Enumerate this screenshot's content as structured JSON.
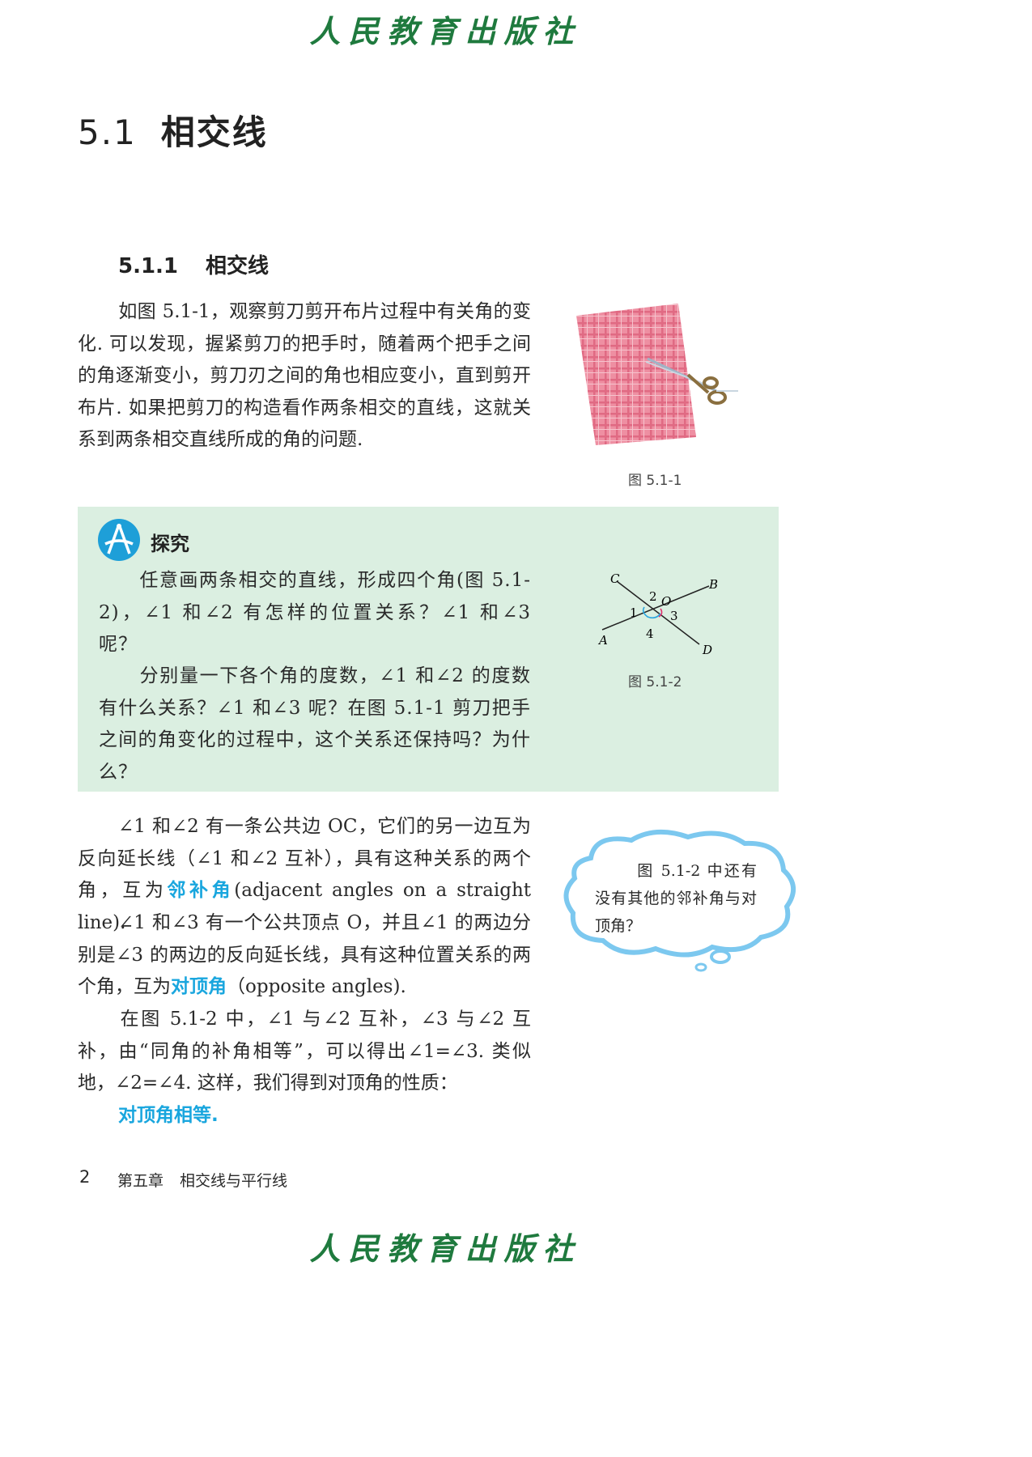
{
  "publisher": "人民教育出版社",
  "section": {
    "number": "5.1",
    "title": "相交线"
  },
  "subsection": {
    "number": "5.1.1",
    "title": "相交线"
  },
  "intro_paragraph": "如图 5.1-1，观察剪刀剪开布片过程中有关角的变化. 可以发现，握紧剪刀的把手时，随着两个把手之间的角逐渐变小，剪刀刃之间的角也相应变小，直到剪开布片. 如果把剪刀的构造看作两条相交的直线，这就关系到两条相交直线所成的角的问题.",
  "figure1": {
    "caption": "图 5.1-1"
  },
  "explore": {
    "label": "探究",
    "para1": "任意画两条相交的直线，形成四个角(图 5.1-2)，∠1 和∠2 有怎样的位置关系？∠1 和∠3 呢？",
    "para2": "分别量一下各个角的度数，∠1 和∠2 的度数有什么关系？∠1 和∠3 呢？在图 5.1-1 剪刀把手之间的角变化的过程中，这个关系还保持吗？为什么？"
  },
  "figure2": {
    "caption": "图 5.1-2",
    "labels": {
      "C": "C",
      "B": "B",
      "A": "A",
      "D": "D",
      "O": "O",
      "a1": "1",
      "a2": "2",
      "a3": "3",
      "a4": "4"
    }
  },
  "adjacent": {
    "text_before": "∠1 和∠2 有一条公共边 OC，它们的另一边互为反向延长线（∠1 和∠2 互补），具有这种关系的两个角，互为",
    "keyword": "邻补角",
    "text_after": "(adjacent angles on a straight line)."
  },
  "opposite": {
    "text_before": "∠1 和∠3 有一个公共顶点 O，并且∠1 的两边分别是∠3 的两边的反向延长线，具有这种位置关系的两个角，互为",
    "keyword": "对顶角",
    "text_after": "（opposite angles)."
  },
  "derivation": "在图 5.1-2 中，∠1 与∠2 互补，∠3 与∠2 互补，由“同角的补角相等”，可以得出∠1=∠3. 类似地，∠2=∠4. 这样，我们得到对顶角的性质：",
  "property": "对顶角相等.",
  "thought_cloud": "图 5.1-2 中还有没有其他的邻补角与对顶角？",
  "footer": {
    "page_number": "2",
    "chapter": "第五章",
    "chapter_title": "相交线与平行线"
  },
  "colors": {
    "brand_green": "#1f7a3e",
    "keyword_blue": "#19a6de",
    "explore_bg": "#dbefe1",
    "cloud_border": "#7cc8ef"
  }
}
